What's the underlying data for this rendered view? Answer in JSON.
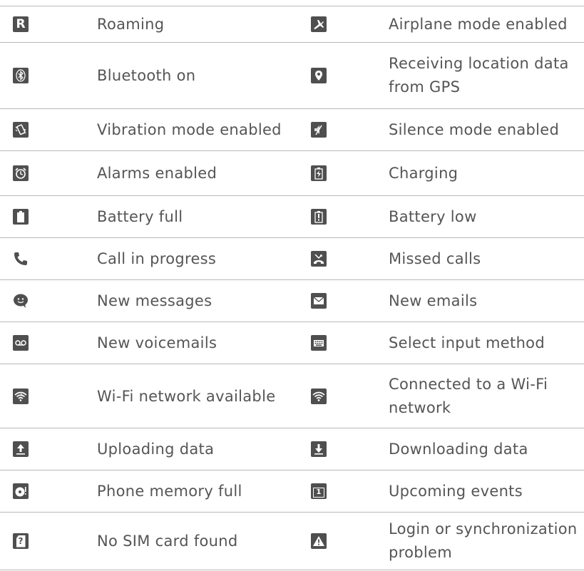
{
  "rows": [
    {
      "left": {
        "icon": "roaming-icon",
        "label": "Roaming"
      },
      "right": {
        "icon": "airplane-icon",
        "label": "Airplane mode enabled"
      }
    },
    {
      "left": {
        "icon": "bluetooth-icon",
        "label": "Bluetooth on"
      },
      "right": {
        "icon": "location-pin-icon",
        "label_line1": "Receiving location data",
        "label_line2": "from GPS"
      }
    },
    {
      "left": {
        "icon": "vibration-icon",
        "label": "Vibration mode enabled"
      },
      "right": {
        "icon": "silence-icon",
        "label": "Silence mode enabled"
      }
    },
    {
      "left": {
        "icon": "alarm-clock-icon",
        "label": "Alarms enabled"
      },
      "right": {
        "icon": "charging-icon",
        "label": "Charging"
      }
    },
    {
      "left": {
        "icon": "battery-full-icon",
        "label": "Battery full"
      },
      "right": {
        "icon": "battery-low-icon",
        "label": "Battery low"
      }
    },
    {
      "left": {
        "icon": "phone-call-icon",
        "label": "Call in progress"
      },
      "right": {
        "icon": "missed-call-icon",
        "label": "Missed calls"
      }
    },
    {
      "left": {
        "icon": "message-bubble-icon",
        "label": "New messages"
      },
      "right": {
        "icon": "envelope-icon",
        "label": "New emails"
      }
    },
    {
      "left": {
        "icon": "voicemail-icon",
        "label": "New voicemails"
      },
      "right": {
        "icon": "keyboard-icon",
        "label": "Select input method"
      }
    },
    {
      "left": {
        "icon": "wifi-available-icon",
        "label": "Wi-Fi network available"
      },
      "right": {
        "icon": "wifi-connected-icon",
        "label_line1": "Connected to a Wi-Fi",
        "label_line2": "network"
      }
    },
    {
      "left": {
        "icon": "upload-icon",
        "label": "Uploading data"
      },
      "right": {
        "icon": "download-icon",
        "label": "Downloading data"
      }
    },
    {
      "left": {
        "icon": "memory-full-icon",
        "label": "Phone memory full"
      },
      "right": {
        "icon": "calendar-icon",
        "label": "Upcoming events",
        "icon_text": "1"
      }
    },
    {
      "left": {
        "icon": "no-sim-icon",
        "label": "No SIM card found",
        "icon_text": "?"
      },
      "right": {
        "icon": "warning-icon",
        "label_line1": "Login or synchronization",
        "label_line2": "problem"
      }
    }
  ],
  "roaming_letter": "R",
  "colors": {
    "icon_bg": "#4f4f4f",
    "text": "#555555",
    "rule": "#b9b9b9"
  }
}
